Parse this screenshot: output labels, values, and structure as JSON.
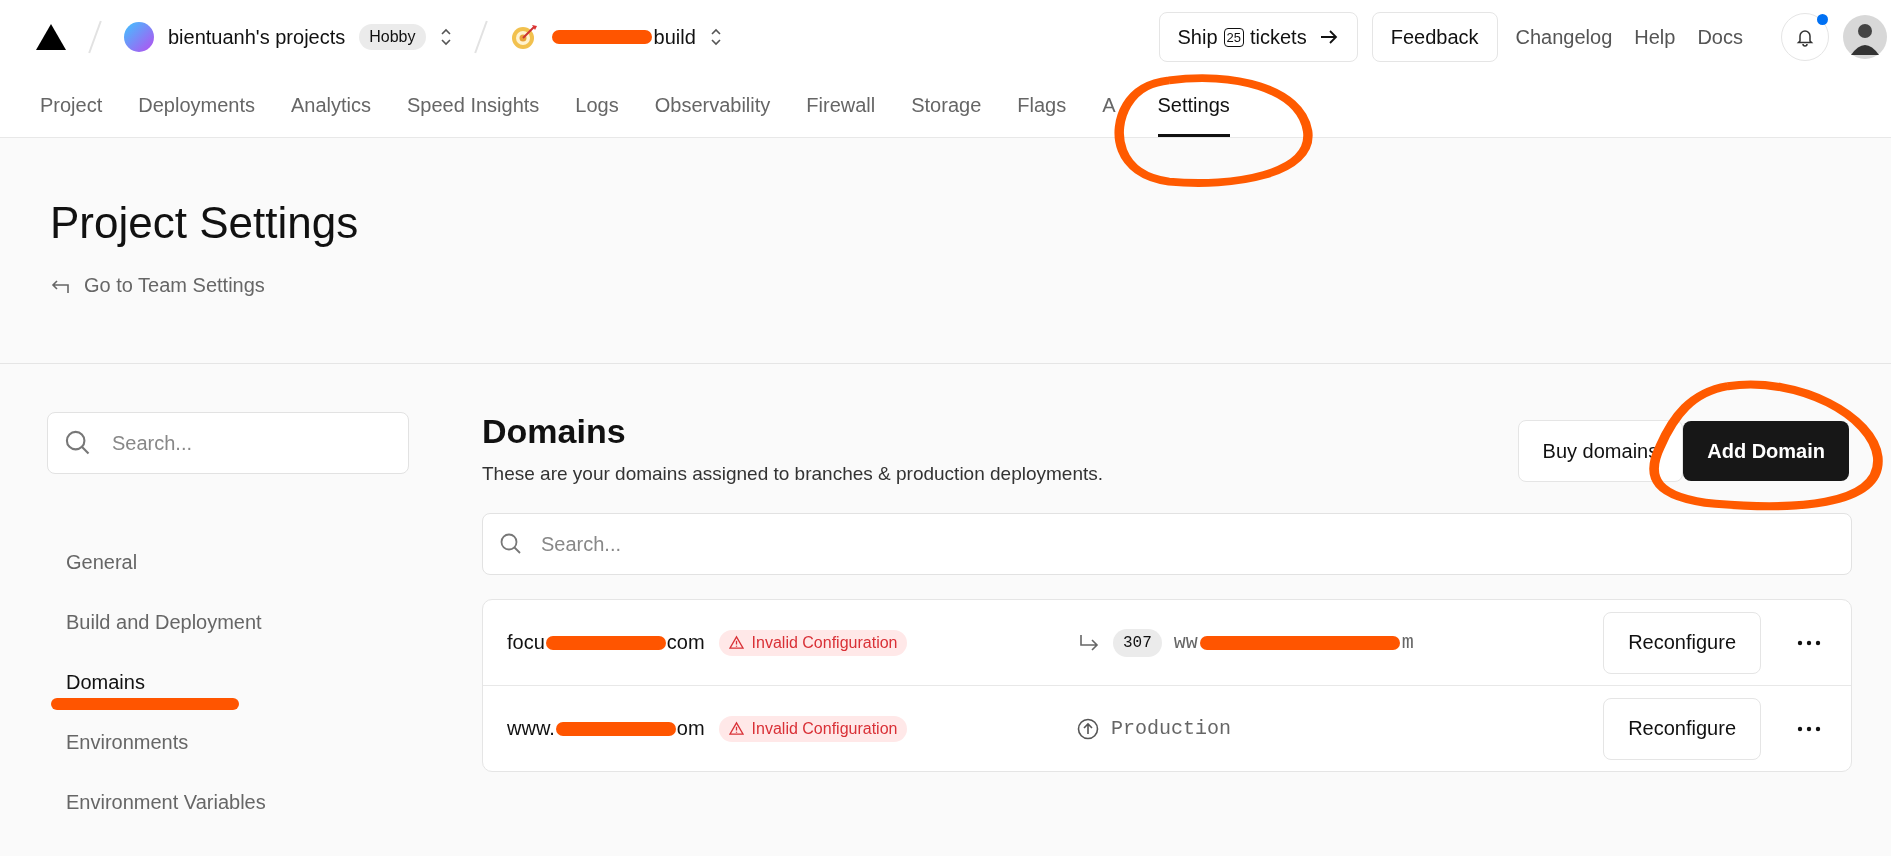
{
  "topbar": {
    "team": {
      "name": "bientuanh's projects",
      "plan": "Hobby"
    },
    "project": {
      "segments": [
        {
          "kind": "redacted"
        },
        {
          "kind": "text",
          "text": "build"
        }
      ]
    },
    "ship": {
      "before": "Ship",
      "count": "25",
      "after": "tickets"
    },
    "feedback": "Feedback",
    "links": [
      "Changelog",
      "Help",
      "Docs"
    ],
    "notifications": {
      "unread": true
    }
  },
  "tabs": [
    {
      "label": "Project",
      "selected": false,
      "circled": false
    },
    {
      "label": "Deployments",
      "selected": false,
      "circled": false
    },
    {
      "label": "Analytics",
      "selected": false,
      "circled": false
    },
    {
      "label": "Speed Insights",
      "selected": false,
      "circled": false
    },
    {
      "label": "Logs",
      "selected": false,
      "circled": false
    },
    {
      "label": "Observability",
      "selected": false,
      "circled": false
    },
    {
      "label": "Firewall",
      "selected": false,
      "circled": false
    },
    {
      "label": "Storage",
      "selected": false,
      "circled": false
    },
    {
      "label": "Flags",
      "selected": false,
      "circled": false
    },
    {
      "label": "A",
      "selected": false,
      "circled": false
    },
    {
      "label": "Settings",
      "selected": true,
      "circled": true
    }
  ],
  "header": {
    "title": "Project Settings",
    "back_link": "Go to Team Settings"
  },
  "sidebar": {
    "search": {
      "placeholder": "Search..."
    },
    "items": [
      {
        "label": "General",
        "selected": false,
        "underlined": false
      },
      {
        "label": "Build and Deployment",
        "selected": false,
        "underlined": false
      },
      {
        "label": "Domains",
        "selected": true,
        "underlined": true
      },
      {
        "label": "Environments",
        "selected": false,
        "underlined": false
      },
      {
        "label": "Environment Variables",
        "selected": false,
        "underlined": false
      }
    ]
  },
  "domains": {
    "title": "Domains",
    "subtitle": "These are your domains assigned to branches & production deployments.",
    "buttons": [
      {
        "label": "Buy domains",
        "kind": "secondary",
        "circled": false
      },
      {
        "label": "Add Domain",
        "kind": "primary",
        "circled": true
      }
    ],
    "search": {
      "placeholder": "Search..."
    },
    "rows": [
      {
        "domain": [
          {
            "kind": "text",
            "text": "focu"
          },
          {
            "kind": "redacted"
          },
          {
            "kind": "text",
            "text": "com"
          }
        ],
        "status": "Invalid Configuration",
        "target": {
          "kind": "redirect",
          "code": "307",
          "segments": [
            {
              "kind": "text",
              "text": "ww"
            },
            {
              "kind": "redacted"
            },
            {
              "kind": "text",
              "text": "m"
            }
          ]
        },
        "action": "Reconfigure"
      },
      {
        "domain": [
          {
            "kind": "text",
            "text": "www."
          },
          {
            "kind": "redacted"
          },
          {
            "kind": "text",
            "text": "om"
          }
        ],
        "status": "Invalid Configuration",
        "target": {
          "kind": "production",
          "label": "Production"
        },
        "action": "Reconfigure"
      }
    ]
  }
}
